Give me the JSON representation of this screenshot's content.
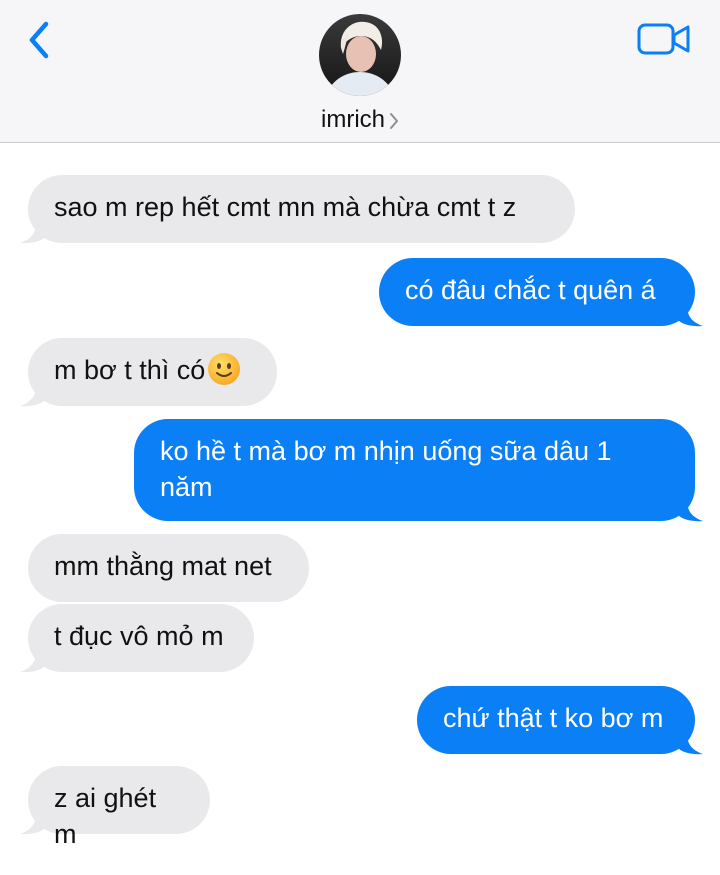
{
  "header": {
    "contact_name": "imrich",
    "colors": {
      "accent": "#0b7ff5",
      "bar": "#f6f6f8"
    },
    "icons": [
      "chevron-left-icon",
      "video-camera-icon",
      "chevron-right-icon"
    ]
  },
  "messages": [
    {
      "direction": "incoming",
      "text": "sao m rep hết cmt mn mà chừa cmt t z"
    },
    {
      "direction": "outgoing",
      "text": "có đâu chắc t quên á"
    },
    {
      "direction": "incoming",
      "text": "m bơ t thì có",
      "emoji": "slightly-smiling-face"
    },
    {
      "direction": "outgoing",
      "text": "ko hề t mà bơ m nhịn uống sữa dâu 1 năm"
    },
    {
      "direction": "incoming",
      "text": "mm thằng mat net"
    },
    {
      "direction": "incoming",
      "text": "t đục vô mỏ m"
    },
    {
      "direction": "outgoing",
      "text": "chứ thật t ko bơ m"
    },
    {
      "direction": "incoming",
      "text": "z ai ghét m"
    }
  ],
  "colors": {
    "incoming_bubble": "#e9e9eb",
    "outgoing_bubble": "#0b7ff5"
  }
}
